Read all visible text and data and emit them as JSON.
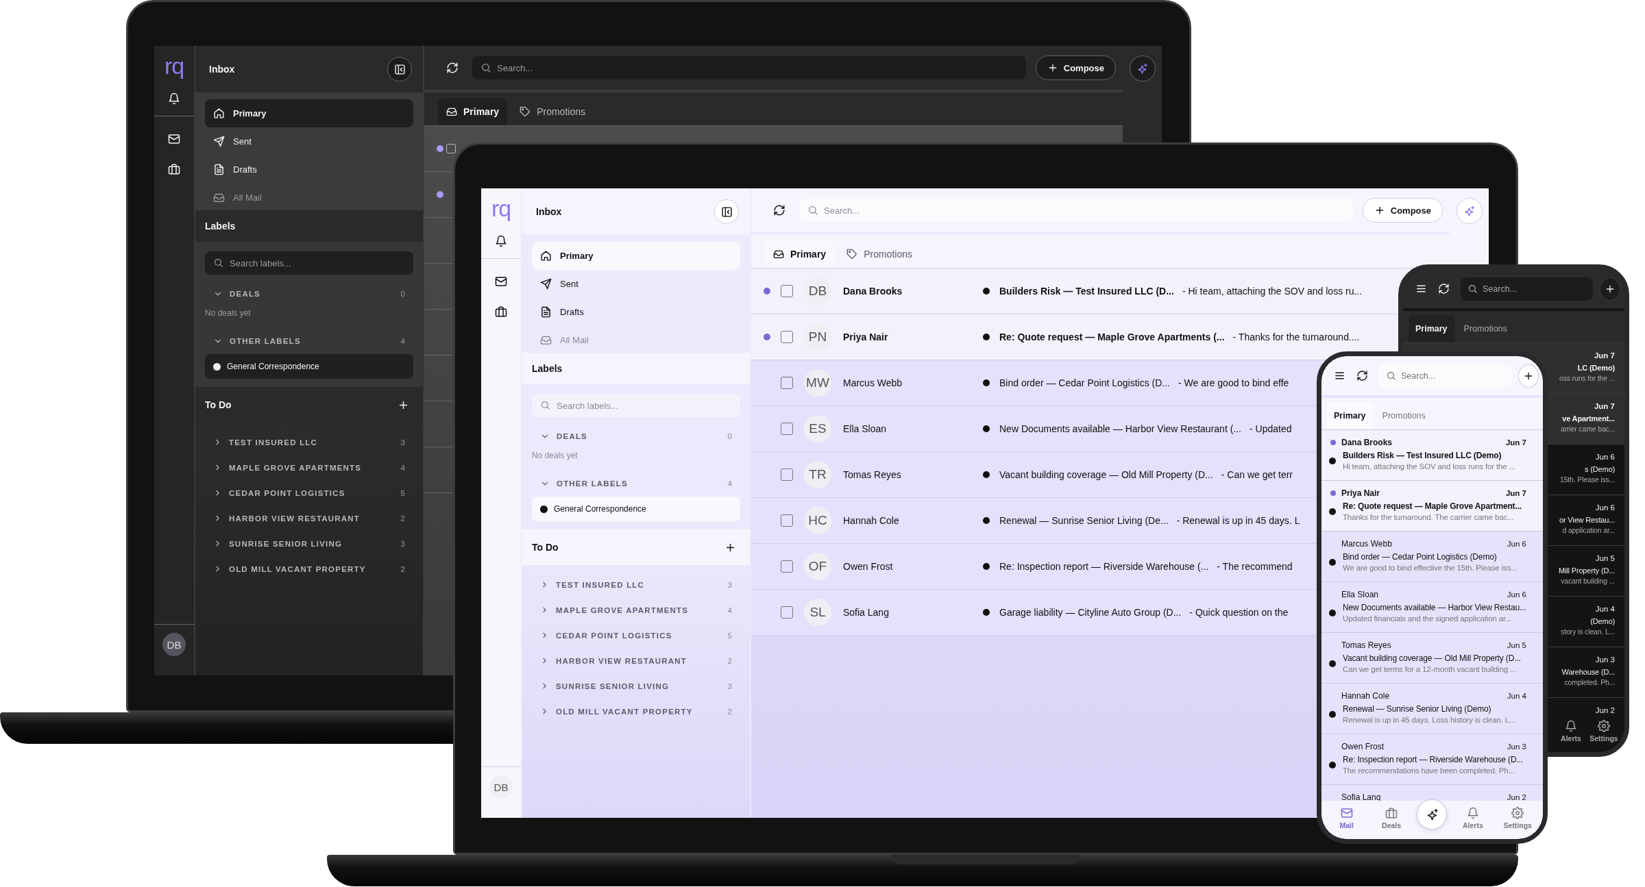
{
  "dark_laptop": {
    "dark": true,
    "logo": "rq",
    "avatar": "DB",
    "title": "Inbox",
    "folders": [
      {
        "kind": "home",
        "label": "Primary",
        "selected": true,
        "disabled": false
      },
      {
        "kind": "send",
        "label": "Sent",
        "selected": false,
        "disabled": false
      },
      {
        "kind": "file",
        "label": "Drafts",
        "selected": false,
        "disabled": false
      },
      {
        "kind": "inbox",
        "label": "All Mail",
        "selected": false,
        "disabled": true
      }
    ],
    "labels_title": "Labels",
    "label_search": {
      "placeholder": "Search labels..."
    },
    "label_groups": [
      {
        "title": "DEALS",
        "count": "0",
        "expanded": true,
        "empty_text": "No deals yet"
      },
      {
        "title": "OTHER LABELS",
        "count": "4",
        "expanded": true,
        "items": [
          "General Correspondence"
        ]
      }
    ],
    "todo_title": "To Do",
    "todo": [
      {
        "name": "TEST INSURED LLC",
        "count": "3",
        "expanded": false
      },
      {
        "name": "MAPLE GROVE APARTMENTS",
        "count": "4",
        "expanded": false
      },
      {
        "name": "CEDAR POINT LOGISTICS",
        "count": "5",
        "expanded": false
      },
      {
        "name": "HARBOR VIEW RESTAURANT",
        "count": "2",
        "expanded": false
      },
      {
        "name": "SUNRISE SENIOR LIVING",
        "count": "3",
        "expanded": false
      },
      {
        "name": "OLD MILL VACANT PROPERTY",
        "count": "2",
        "expanded": false
      }
    ],
    "search": {
      "placeholder": "Search..."
    },
    "compose": "Compose",
    "tabs": [
      {
        "kind": "inbox",
        "label": "Primary",
        "selected": true
      },
      {
        "kind": "tag",
        "label": "Promotions",
        "selected": false
      }
    ],
    "rows": [
      {
        "unread": true,
        "checked": false
      },
      {
        "unread": true
      },
      {
        "unread": false
      },
      {
        "unread": false
      },
      {
        "unread": false
      },
      {
        "unread": false
      },
      {
        "unread": false
      },
      {
        "unread": false
      }
    ]
  },
  "light_laptop": {
    "dark": false,
    "logo": "rq",
    "avatar": "DB",
    "title": "Inbox",
    "folders": [
      {
        "kind": "home",
        "label": "Primary",
        "selected": true,
        "disabled": false
      },
      {
        "kind": "send",
        "label": "Sent",
        "selected": false,
        "disabled": false
      },
      {
        "kind": "file",
        "label": "Drafts",
        "selected": false,
        "disabled": false
      },
      {
        "kind": "inbox",
        "label": "All Mail",
        "selected": false,
        "disabled": true
      }
    ],
    "labels_title": "Labels",
    "label_search": {
      "placeholder": "Search labels..."
    },
    "label_groups": [
      {
        "title": "DEALS",
        "count": "0",
        "expanded": true,
        "empty_text": "No deals yet"
      },
      {
        "title": "OTHER LABELS",
        "count": "4",
        "expanded": true,
        "items": [
          "General Correspondence"
        ]
      }
    ],
    "todo_title": "To Do",
    "todo": [
      {
        "name": "TEST INSURED LLC",
        "count": "3",
        "expanded": false
      },
      {
        "name": "MAPLE GROVE APARTMENTS",
        "count": "4",
        "expanded": false
      },
      {
        "name": "CEDAR POINT LOGISTICS",
        "count": "5",
        "expanded": false
      },
      {
        "name": "HARBOR VIEW RESTAURANT",
        "count": "2",
        "expanded": false
      },
      {
        "name": "SUNRISE SENIOR LIVING",
        "count": "3",
        "expanded": false
      },
      {
        "name": "OLD MILL VACANT PROPERTY",
        "count": "2",
        "expanded": false
      }
    ],
    "search": {
      "placeholder": "Search..."
    },
    "compose": "Compose",
    "tabs": [
      {
        "kind": "inbox",
        "label": "Primary",
        "selected": true
      },
      {
        "kind": "tag",
        "label": "Promotions",
        "selected": false
      }
    ],
    "rows": [
      {
        "unread": true,
        "checked": false,
        "avatar": "DB",
        "sender": "Dana Brooks",
        "subject": "Builders Risk — Test Insured LLC (D...",
        "preview": "- Hi team, attaching the SOV and loss ru..."
      },
      {
        "unread": true,
        "checked": false,
        "avatar": "PN",
        "sender": "Priya Nair",
        "subject": "Re: Quote request — Maple Grove Apartments (...",
        "preview": "- Thanks for the turnaround...."
      },
      {
        "unread": false,
        "checked": false,
        "avatar": "MW",
        "sender": "Marcus Webb",
        "subject": "Bind order — Cedar Point Logistics (D...",
        "preview": "- We are good to bind effe"
      },
      {
        "unread": false,
        "checked": false,
        "avatar": "ES",
        "sender": "Ella Sloan",
        "subject": "New Documents available — Harbor View Restaurant (...",
        "preview": "- Updated"
      },
      {
        "unread": false,
        "checked": false,
        "avatar": "TR",
        "sender": "Tomas Reyes",
        "subject": "Vacant building coverage — Old Mill Property (D...",
        "preview": "- Can we get terr"
      },
      {
        "unread": false,
        "checked": false,
        "avatar": "HC",
        "sender": "Hannah Cole",
        "subject": "Renewal — Sunrise Senior Living (De...",
        "preview": "- Renewal is up in 45 days. L"
      },
      {
        "unread": false,
        "checked": false,
        "avatar": "OF",
        "sender": "Owen Frost",
        "subject": "Re: Inspection report — Riverside Warehouse (...",
        "preview": "- The recommend"
      },
      {
        "unread": false,
        "checked": false,
        "avatar": "SL",
        "sender": "Sofia Lang",
        "subject": "Garage liability — Cityline Auto Group (D...",
        "preview": "- Quick question on the"
      }
    ]
  },
  "dark_phone": {
    "dark": true,
    "search": {
      "placeholder": "Search..."
    },
    "tabs": [
      {
        "label": "Primary",
        "selected": true
      },
      {
        "label": "Promotions",
        "selected": false
      }
    ],
    "rows": [
      {
        "unread": true,
        "date": "Jun 7",
        "subject": "LC (Demo)",
        "preview": "oss runs for the ..."
      },
      {
        "unread": true,
        "date": "Jun 7",
        "subject": "ve Apartment...",
        "preview": "arrier came bac..."
      },
      {
        "unread": false,
        "date": "Jun 6",
        "subject": "s (Demo)",
        "preview": "15th. Please iss..."
      },
      {
        "unread": false,
        "date": "Jun 6",
        "subject": "or View Restau...",
        "preview": "d application ar..."
      },
      {
        "unread": false,
        "date": "Jun 5",
        "subject": "Mill Property (D...",
        "preview": "vacant building ..."
      },
      {
        "unread": false,
        "date": "Jun 4",
        "subject": "(Demo)",
        "preview": "story is clean. L..."
      },
      {
        "unread": false,
        "date": "Jun 3",
        "subject": "Warehouse (D...",
        "preview": "completed. Ph..."
      },
      {
        "unread": false,
        "date": "Jun 2"
      }
    ],
    "nav": [
      {
        "kind": "bell",
        "label": "Alerts",
        "selected": false
      },
      {
        "kind": "gear",
        "label": "Settings",
        "selected": false
      }
    ]
  },
  "light_phone": {
    "dark": false,
    "search": {
      "placeholder": "Search..."
    },
    "tabs": [
      {
        "label": "Primary",
        "selected": true
      },
      {
        "label": "Promotions",
        "selected": false
      }
    ],
    "rows": [
      {
        "unread": true,
        "sender": "Dana Brooks",
        "date": "Jun 7",
        "subject": "Builders Risk — Test Insured LLC (Demo)",
        "preview": "Hi team, attaching the SOV and loss runs for the ..."
      },
      {
        "unread": true,
        "sender": "Priya Nair",
        "date": "Jun 7",
        "subject": "Re: Quote request — Maple Grove Apartment...",
        "preview": "Thanks for the turnaround. The carrier came bac..."
      },
      {
        "unread": false,
        "sender": "Marcus Webb",
        "date": "Jun 6",
        "subject": "Bind order — Cedar Point Logistics (Demo)",
        "preview": "We are good to bind effective the 15th. Please iss..."
      },
      {
        "unread": false,
        "sender": "Ella Sloan",
        "date": "Jun 6",
        "subject": "New Documents available — Harbor View Restau...",
        "preview": "Updated financials and the signed application ar..."
      },
      {
        "unread": false,
        "sender": "Tomas Reyes",
        "date": "Jun 5",
        "subject": "Vacant building coverage — Old Mill Property (D...",
        "preview": "Can we get terms for a 12-month vacant building ..."
      },
      {
        "unread": false,
        "sender": "Hannah Cole",
        "date": "Jun 4",
        "subject": "Renewal — Sunrise Senior Living (Demo)",
        "preview": "Renewal is up in 45 days. Loss history is clean. L..."
      },
      {
        "unread": false,
        "sender": "Owen Frost",
        "date": "Jun 3",
        "subject": "Re: Inspection report — Riverside Warehouse (D...",
        "preview": "The recommendations have been completed. Ph..."
      },
      {
        "unread": false,
        "sender": "Sofia Lang",
        "date": "Jun 2"
      }
    ],
    "nav": [
      {
        "kind": "mail",
        "label": "Mail",
        "selected": true
      },
      {
        "kind": "briefcase",
        "label": "Deals",
        "selected": false
      },
      {
        "kind": "sparkle"
      },
      {
        "kind": "bell",
        "label": "Alerts",
        "selected": false
      },
      {
        "kind": "gear",
        "label": "Settings",
        "selected": false
      }
    ]
  }
}
